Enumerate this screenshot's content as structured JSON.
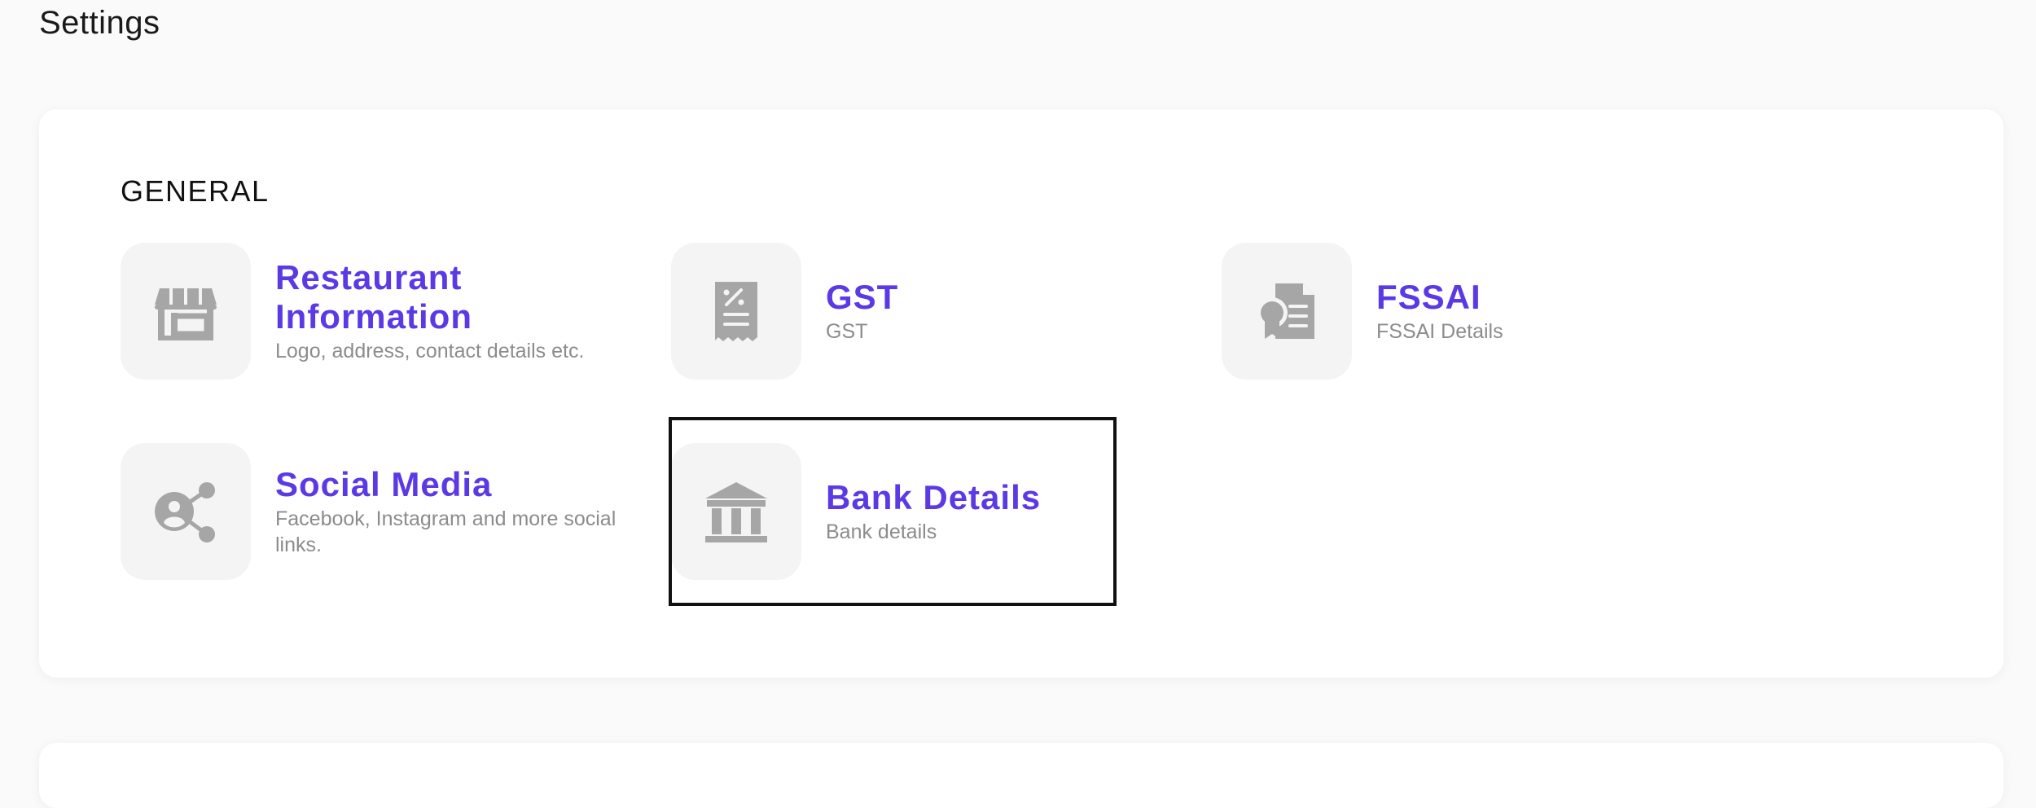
{
  "page": {
    "title": "Settings"
  },
  "general": {
    "heading": "GENERAL",
    "items": [
      {
        "title_line1": "Restaurant",
        "title_line2": "Information",
        "description": "Logo, address, contact details etc.",
        "icon": "storefront-icon"
      },
      {
        "title": "GST",
        "description": "GST",
        "icon": "receipt-icon"
      },
      {
        "title": "FSSAI",
        "description": "FSSAI Details",
        "icon": "certificate-icon"
      },
      {
        "title": "Social Media",
        "desc_line1": "Facebook, Instagram and more social",
        "desc_line2": "links.",
        "icon": "social-share-icon"
      },
      {
        "title": "Bank Details",
        "description": "Bank details",
        "icon": "bank-icon"
      }
    ]
  },
  "colors": {
    "accent": "#5b3ae6",
    "icon_gray": "#a6a6a6",
    "tile_bg": "#f4f4f4"
  }
}
